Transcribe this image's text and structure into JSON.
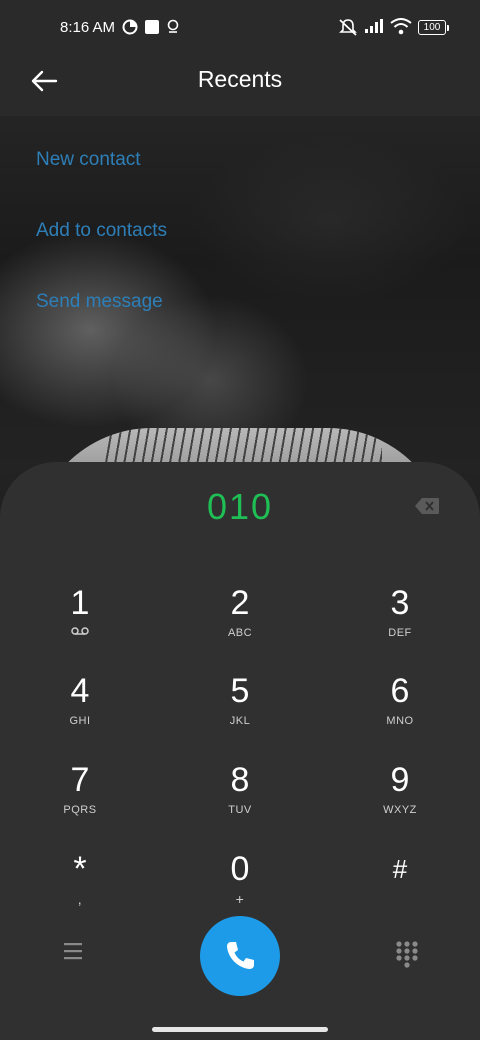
{
  "status_bar": {
    "time": "8:16 AM",
    "battery": "100",
    "icons": [
      "data-saver-icon",
      "square-notification-icon",
      "location-pin-icon",
      "mute-icon",
      "signal-icon",
      "wifi-icon",
      "battery-icon"
    ]
  },
  "header": {
    "title": "Recents",
    "back_icon": "arrow-left-icon"
  },
  "actions": [
    {
      "label": "New contact"
    },
    {
      "label": "Add to contacts"
    },
    {
      "label": "Send message"
    }
  ],
  "dialer": {
    "number": "010",
    "number_color": "#1fbf55",
    "keys": [
      {
        "digit": "1",
        "letters": "voicemail-icon"
      },
      {
        "digit": "2",
        "letters": "ABC"
      },
      {
        "digit": "3",
        "letters": "DEF"
      },
      {
        "digit": "4",
        "letters": "GHI"
      },
      {
        "digit": "5",
        "letters": "JKL"
      },
      {
        "digit": "6",
        "letters": "MNO"
      },
      {
        "digit": "7",
        "letters": "PQRS"
      },
      {
        "digit": "8",
        "letters": "TUV"
      },
      {
        "digit": "9",
        "letters": "WXYZ"
      },
      {
        "digit": "*",
        "letters": ","
      },
      {
        "digit": "0",
        "letters": "+"
      },
      {
        "digit": "#",
        "letters": ""
      }
    ],
    "call_button_color": "#1d9be8"
  },
  "colors": {
    "action_link": "#2e7fb8",
    "pad_background": "#303030"
  }
}
